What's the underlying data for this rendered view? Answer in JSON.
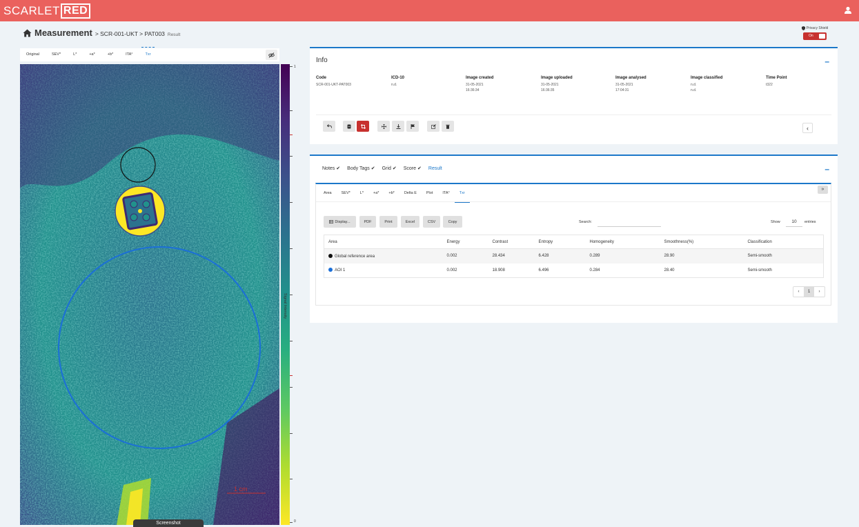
{
  "brand": {
    "part1": "SCARLET",
    "part2": "RED",
    "color": "#ea615d"
  },
  "breadcrumb": {
    "title": "Measurement",
    "path": "> SCR-001-UKT > PAT003",
    "tail": "Result"
  },
  "privacy": {
    "label": "Privacy Shield",
    "toggle": "On"
  },
  "image_tabs": [
    "Original",
    "SEV*",
    "L*",
    "+a*",
    "+b*",
    "ITA°",
    "Txr"
  ],
  "image_tabs_active": "Txr",
  "colorbar": {
    "top": "1",
    "bottom": "0",
    "axis_label": "Signal Intensity",
    "scale_label": "1 cm"
  },
  "tooltip": "Screenshot",
  "info": {
    "title": "Info",
    "columns": [
      {
        "header": "Code",
        "lines": [
          "SCR-001-UKT-PAT003"
        ]
      },
      {
        "header": "ICD-10",
        "lines": [
          "n.d."
        ]
      },
      {
        "header": "Image created",
        "lines": [
          "31-05-2021",
          "16:36:34"
        ]
      },
      {
        "header": "Image uploaded",
        "lines": [
          "31-05-2021",
          "16:36:35"
        ]
      },
      {
        "header": "Image analysed",
        "lines": [
          "31-05-2021",
          "17:04:31"
        ]
      },
      {
        "header": "Image classified",
        "lines": [
          "n.d.",
          "n.d."
        ]
      },
      {
        "header": "Time Point",
        "lines": [
          "t322"
        ]
      }
    ]
  },
  "result": {
    "tabs": [
      {
        "label": "Notes",
        "checked": true
      },
      {
        "label": "Body Tags",
        "checked": true
      },
      {
        "label": "Grid",
        "checked": true
      },
      {
        "label": "Score",
        "checked": true
      },
      {
        "label": "Result",
        "checked": false
      }
    ],
    "sub_tabs": [
      "Area",
      "SEV*",
      "L*",
      "+a*",
      "+b*",
      "Delta E",
      "Plot",
      "ITA°",
      "Txr"
    ],
    "sub_tabs_active": "Txr",
    "buttons": [
      "Display...",
      "PDF",
      "Print",
      "Excel",
      "CSV",
      "Copy"
    ],
    "search_label": "Search:",
    "show_label": "Show",
    "entries_value": "10",
    "entries_label": "entries",
    "table": {
      "headers": [
        "Area",
        "Energy",
        "Contrast",
        "Entropy",
        "Homogeneity",
        "Smoothness(%)",
        "Classification"
      ],
      "rows": [
        {
          "color": "#111111",
          "cells": [
            "Global reference area",
            "0.002",
            "28.434",
            "6.428",
            "0.289",
            "28.90",
            "Semi-smooth"
          ]
        },
        {
          "color": "#1b6fd8",
          "cells": [
            "AOI 1",
            "0.002",
            "18.908",
            "6.496",
            "0.284",
            "28.40",
            "Semi-smooth"
          ]
        }
      ]
    },
    "pager": {
      "prev": "‹",
      "page": "1",
      "next": "›"
    }
  }
}
